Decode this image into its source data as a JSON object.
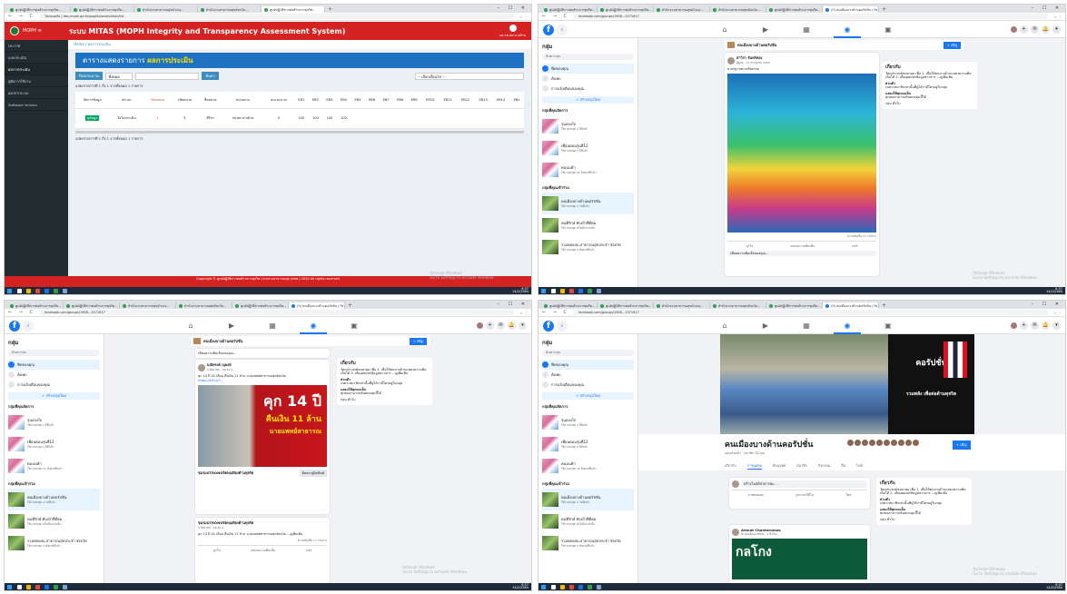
{
  "browser": {
    "tabs_mitas": [
      "ศูนย์ปฏิบัติการต่อต้านการทุจริต...",
      "ศูนย์ปฏิบัติการต่อต้านการทุจริต...",
      "สำนักงานสาธารณสุขอำเภอ...",
      "สำนักงานสาธารณสุขจังหวัด...",
      "ศูนย์ปฏิบัติการต่อต้านการทุจริต..."
    ],
    "tabs_fb": [
      "ศูนย์ปฏิบัติการต่อต้านการทุจริต...",
      "ศูนย์ปฏิบัติการต่อต้านการทุจริต...",
      "สำนักงานสาธารณสุขอำเภอ...",
      "สำนักงานสาธารณสุขจังหวัด...",
      "ศูนย์ปฏิบัติการต่อต้านการทุจริต...",
      "(9) คนเมืองบางด้านคอรัปชั่น | Fa..."
    ],
    "url_mitas": "ไม่ปลอดภัย | itas.moph.go.th/app/ita/evaluation/list",
    "url_fb": "facebook.com/groups/1908...1571617",
    "win_controls": "–  ☐  ✕",
    "activate_title": "Activate Windows",
    "activate_sub": "Go to Settings to activate Windows.",
    "clock_time": "9:37",
    "clock_date": "14/2/2564"
  },
  "mitas": {
    "brand": "MOPH ≡",
    "system_title": "ระบบ MITAS (MOPH Integrity and Transparency Assessment System)",
    "user_label": "ผอ.รพ.สต.บางด้าน",
    "sidebar": [
      "ประกาศ",
      "แบบประเมิน",
      "ผลการประเมิน",
      "คู่มือการใช้งาน",
      "ออกจากระบบ",
      "Software Version"
    ],
    "breadcrumb": "Home / ผลการประเมิน",
    "panel_title": "ตารางแสดงรายการ",
    "panel_title_em": "ผลการประเมิน",
    "filter_btn": "ปีงบประมาณ",
    "filter_year": "ทั้งหมด",
    "filter_search": "ค้นหา",
    "filter_select": "-- เลือกเงื่อนไข --",
    "info_top": "แสดงรายการที่ 1 ถึง 1 จากทั้งหมด 1 รายการ",
    "columns": [
      "จัดการข้อมูล",
      "สถานะ",
      "Yanuana",
      "รหัสหน่วย",
      "ชื่อหน่วย",
      "หน่วยงาน",
      "คะแนนรวม",
      "EB1",
      "EB2",
      "EB3",
      "EB4",
      "EB5",
      "EB6",
      "EB7",
      "EB8",
      "EB9",
      "EB10",
      "EB11",
      "EB12",
      "EB13",
      "EB14",
      "EB1"
    ],
    "row": [
      "ดูข้อมูล",
      "ยังไม่ประเมิน",
      "1",
      "3",
      "ศิริกร",
      "รพ.สต.บางด้าน",
      "5",
      "100",
      "100",
      "100",
      "100",
      "",
      "",
      "",
      "",
      "",
      "",
      "",
      "",
      "",
      "",
      ""
    ],
    "info_bottom": "แสดงรายการที่ 1 ถึง 1 จากทั้งหมด 1 รายการ",
    "footer": "Copyright © ศูนย์ปฏิบัติการต่อต้านการทุจริต กระทรวงสาธารณสุข (ศปท.) 2020 All rights reserved"
  },
  "fb": {
    "sidebar_title": "กลุ่ม",
    "search_placeholder": "ค้นหากลุ่ม",
    "menu": [
      "ฟีดของคุณ",
      "ค้นพบ",
      "การแจ้งเตือนของคุณ"
    ],
    "create": "+ สร้างกลุ่มใหม่",
    "managed_title": "กลุ่มที่คุณจัดการ",
    "managed": [
      {
        "name": "รุ่นลองใจ",
        "meta": "ใช้งานล่าสุด 2 ปีที่แล้ว"
      },
      {
        "name": "เพื่อนตอนรุ่นที่12",
        "meta": "ใช้งานล่าสุด 5 ปีที่แล้ว"
      },
      {
        "name": "คนบนฟ้า",
        "meta": "ใช้งานล่าสุด 21 สัปดาห์ที่แล้ว"
      }
    ],
    "joined_title": "กลุ่มที่คุณเข้าร่วม",
    "joined": [
      {
        "name": "คนเมืองบางด้านคอรัปชั่น",
        "meta": "ใช้งานล่าสุด 4 วันที่แล้ว"
      },
      {
        "name": "คนที่รักษ์ ทับเป้าที่ดีคม",
        "meta": "ใช้งานล่าสุด ครั้งเดียวเท่านั้น"
      },
      {
        "name": "รวมพลอสม.สาธารณสุขประจำ จังหวัด",
        "meta": "ใช้งานล่าสุด 4 สัปดาห์ที่แล้ว"
      }
    ],
    "group_name": "คนเมืองบางด้านคอรัปชั่น",
    "group_meta": "กลุ่มส่วนตัว · สมาชิก 32 คน",
    "join": "+ เชิญ",
    "about_title": "เกี่ยวกับ",
    "about_text": "วัตถุประสงค์ของกลุ่ม เพื่อ 1. เพื่อให้คนบางด้านแสดงความคิดเห็นได้ 2. เพื่อเผยแพร่ข้อมูลข่าวสาร ...ดูเพิ่มเติม",
    "about_private": "ส่วนตัว",
    "about_private_sub": "เฉพาะสมาชิกเท่านั้นที่ดูได้ว่ามีใครอยู่ในกลุ่ม",
    "about_visible": "แสดงให้ทุกคนเห็น",
    "about_visible_sub": "ทุกคนสามารถค้นพบกลุ่มนี้ได้",
    "about_place": "กลุ่ม ทั่วไป",
    "post1_author": "สาวิกา จันทร์ทอง",
    "post1_time": "ผู้ดูแล · 17 กรกฎาคม 2563",
    "post1_text": "มาตรฐานทางจริยธรรม",
    "post_comments": "ความคิดเห็น 17 รายการ",
    "act_like": "ถูกใจ",
    "act_comment": "แสดงความคิดเห็น",
    "act_share": "แชร์",
    "comment_ph": "เขียนความคิดเห็นของคุณ...",
    "post2_author": "มณีทรงค์ ณุพงษ์",
    "post2_time": "5 สิงหาคม · 09:10 น.",
    "post2_text": "คุก 14 ปี 42 เดือน คืนเงิน 11 ล้าน นายแพทย์สาธารณสุขจังหวัด",
    "post2_link": "https://bit.ly/3...",
    "news_headline": "คุก 14 ปี",
    "news_line2": "คืนเงิน 11 ล้าน",
    "news_line3": "นายแพทย์สาธารณ",
    "news_caption": "ชมรมSTRONGจิตพอเพียงต้านทุจริต",
    "news_follow": "ติดตามผู้จัดพิมพ์",
    "post3_author": "ชมรมSTRONGจิตพอเพียงต้านทุจริต",
    "post3_time": "5 สิงหาคม · 09:40 น.",
    "post3_text": "คุก 14 ปี 42 เดือน คืนเงิน 11 ล้าน นายแพทย์สาธารณสุขจังหวัด ...ดูเพิ่มเติม",
    "cover_text": "คอรัปชั่น",
    "cover_sub": "รวมพลัง เพื่อต่อต้านทุจริต",
    "gtabs": [
      "เกี่ยวกับ",
      "การพูดคุย",
      "ห้องแชท",
      "สมาชิก",
      "กิจกรรม",
      "สื่อ",
      "ไฟล์"
    ],
    "write_ph": "สร้างโพสต์สาธารณะ...",
    "btn_live": "ถ่ายทอดสด",
    "btn_photo": "รูปภาพ/วิดีโอ",
    "btn_poll": "โพล",
    "post4_author": "Amnat Chantaramas",
    "post4_time": "ถึง คนเมืองบางด้าน · 1 ชั่วโมง",
    "post4_img": "กลโกง"
  }
}
